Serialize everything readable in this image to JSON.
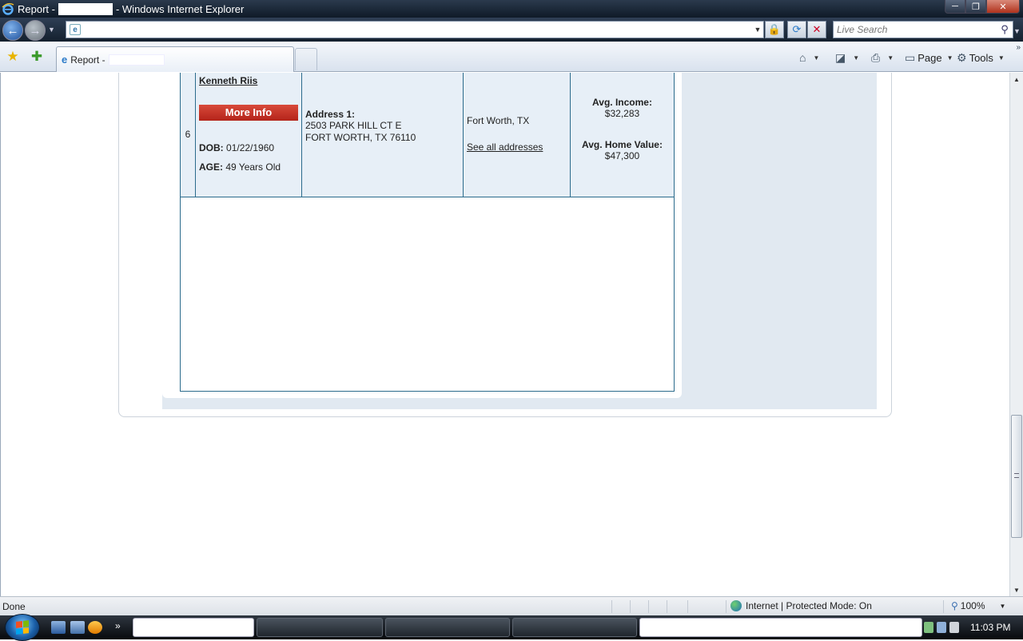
{
  "window": {
    "title_prefix": "Report -",
    "title_suffix": "- Windows Internet Explorer",
    "min": "─",
    "max": "❐",
    "close": "✕"
  },
  "address_bar": {
    "url": "",
    "search_placeholder": "Live Search"
  },
  "tabs": {
    "active_label": "Report -"
  },
  "command_bar": {
    "page_label": "Page",
    "tools_label": "Tools"
  },
  "result": {
    "index": "6",
    "name": "Kenneth Riis",
    "more_info_label": "More Info",
    "dob_label": "DOB:",
    "dob_value": "01/22/1960",
    "age_label": "AGE:",
    "age_value": "49 Years Old",
    "address_label": "Address 1:",
    "address_line1": "2503 PARK HILL CT E",
    "address_line2": "FORT WORTH, TX 76110",
    "city": "Fort Worth, TX",
    "see_all_label": "See all addresses",
    "avg_income_label": "Avg. Income:",
    "avg_income_value": "$32,283",
    "avg_home_label": "Avg. Home Value:",
    "avg_home_value": "$47,300"
  },
  "status_bar": {
    "status": "Done",
    "zone": "Internet | Protected Mode: On",
    "zoom": "100%"
  },
  "taskbar": {
    "time": "11:03 PM"
  },
  "colors": {
    "accent_red": "#c2291d",
    "table_border": "#2b6b8c",
    "row_bg": "#e7eff7",
    "content_bg": "#e1e9f1"
  }
}
